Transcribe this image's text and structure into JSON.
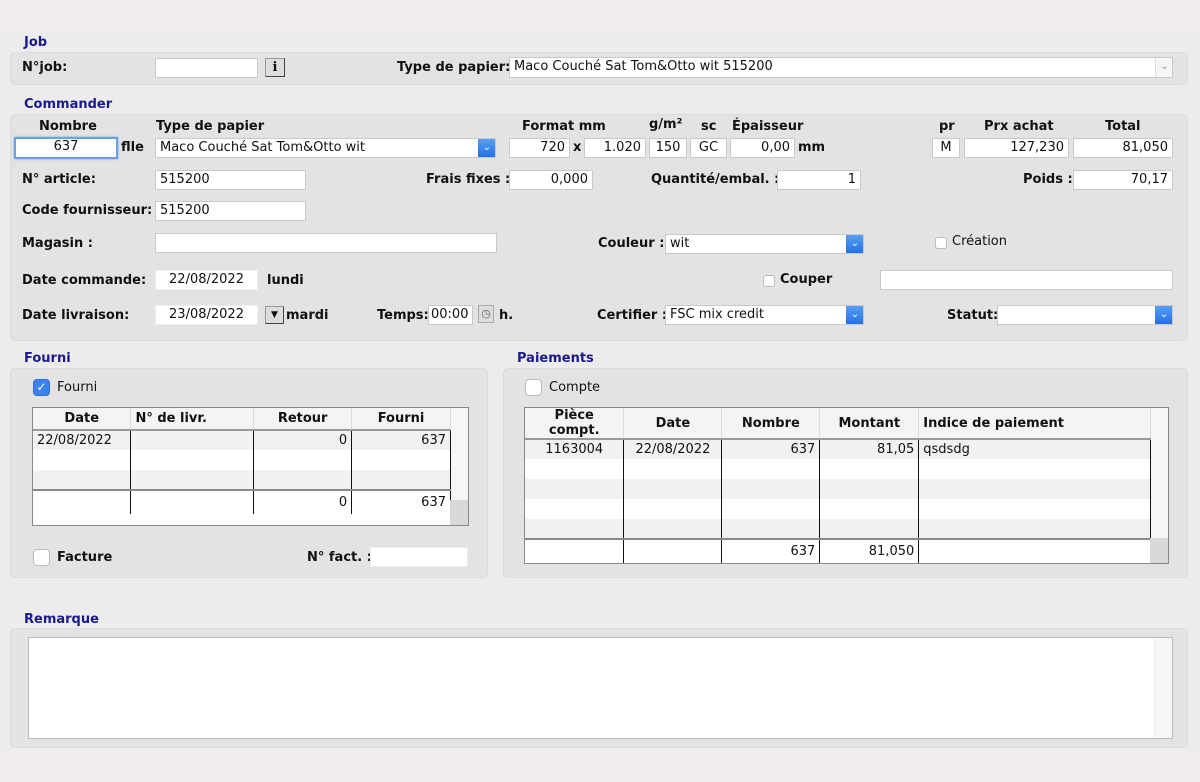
{
  "job": {
    "section_title": "Job",
    "njob_label": "N°job:",
    "njob_value": "",
    "info_button": "i",
    "type_papier_label": "Type de papier:",
    "type_papier_value": "Maco Couché Sat Tom&Otto wit 515200"
  },
  "commander": {
    "section_title": "Commander",
    "headers": {
      "nombre": "Nombre",
      "type_papier": "Type de papier",
      "format": "Format mm",
      "gsm": "g/m²",
      "sc": "sc",
      "epaisseur": "Épaisseur",
      "pr": "pr",
      "prx_achat": "Prx achat",
      "total": "Total"
    },
    "nombre_value": "637",
    "unit_label": "flle",
    "type_papier_value": "Maco Couché Sat Tom&Otto wit",
    "format_w": "720",
    "format_x": "x",
    "format_h": "1.020",
    "gsm_value": "150",
    "sc_value": "GC",
    "epaisseur_value": "0,00",
    "epaisseur_unit": "mm",
    "pr_value": "M",
    "prx_achat_value": "127,230",
    "total_value": "81,050",
    "article_label": "N° article:",
    "article_value": "515200",
    "frais_fixes_label": "Frais fixes :",
    "frais_fixes_value": "0,000",
    "quantite_label": "Quantité/embal. :",
    "quantite_value": "1",
    "poids_label": "Poids :",
    "poids_value": "70,17",
    "code_fournisseur_label": "Code fournisseur:",
    "code_fournisseur_value": "515200",
    "magasin_label": "Magasin :",
    "magasin_value": "",
    "couleur_label": "Couleur :",
    "couleur_value": "wit",
    "creation_label": "Création",
    "creation_checked": false,
    "date_commande_label": "Date commande:",
    "date_commande_value": "22/08/2022",
    "date_commande_day": "lundi",
    "couper_label": "Couper",
    "couper_checked": false,
    "couper_value": "",
    "date_livraison_label": "Date livraison:",
    "date_livraison_value": "23/08/2022",
    "date_livraison_day": "mardi",
    "temps_label": "Temps:",
    "temps_value": "00:00",
    "temps_unit": "h.",
    "certifier_label": "Certifier :",
    "certifier_value": "FSC mix credit",
    "statut_label": "Statut:",
    "statut_value": ""
  },
  "fourni": {
    "section_title": "Fourni",
    "checkbox_label": "Fourni",
    "checked": true,
    "columns": [
      "Date",
      "N° de livr.",
      "Retour",
      "Fourni"
    ],
    "rows": [
      [
        "22/08/2022",
        "",
        "0",
        "637"
      ],
      [
        "",
        "",
        "",
        ""
      ],
      [
        "",
        "",
        "",
        ""
      ]
    ],
    "totals": [
      "",
      "",
      "0",
      "637"
    ],
    "facture_label": "Facture",
    "facture_checked": false,
    "nfact_label": "N° fact. :",
    "nfact_value": ""
  },
  "paiements": {
    "section_title": "Paiements",
    "checkbox_label": "Compte",
    "checked": false,
    "columns": [
      "Pièce compt.",
      "Date",
      "Nombre",
      "Montant",
      "Indice de paiement"
    ],
    "rows": [
      [
        "1163004",
        "22/08/2022",
        "637",
        "81,05",
        "qsdsdg"
      ],
      [
        "",
        "",
        "",
        "",
        ""
      ],
      [
        "",
        "",
        "",
        "",
        ""
      ],
      [
        "",
        "",
        "",
        "",
        ""
      ],
      [
        "",
        "",
        "",
        "",
        ""
      ]
    ],
    "totals": [
      "",
      "",
      "637",
      "81,050",
      ""
    ]
  },
  "remarque": {
    "section_title": "Remarque",
    "value": ""
  },
  "icons": {
    "chevron": "⌄",
    "check": "✓",
    "dropdown_arrow": "▼",
    "clock": "◷"
  }
}
